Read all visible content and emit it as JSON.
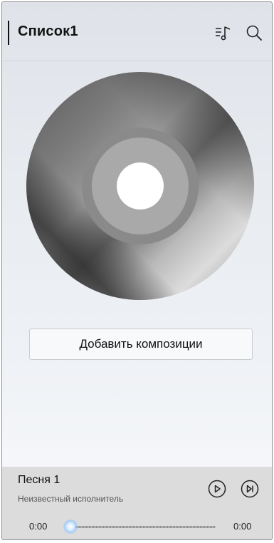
{
  "header": {
    "title": "Список1",
    "icons": [
      "playlist-music-icon",
      "search-icon"
    ]
  },
  "main": {
    "artwork": "vinyl-disc",
    "add_button_label": "Добавить композиции"
  },
  "player": {
    "song_title": "Песня 1",
    "artist": "Неизвестный исполнитель",
    "current_time": "0:00",
    "total_time": "0:00",
    "progress": 0,
    "icons": [
      "play-icon",
      "next-track-icon"
    ]
  },
  "colors": {
    "player_background": "#dcdcdc",
    "text_primary": "#111111",
    "text_secondary": "#555555"
  }
}
